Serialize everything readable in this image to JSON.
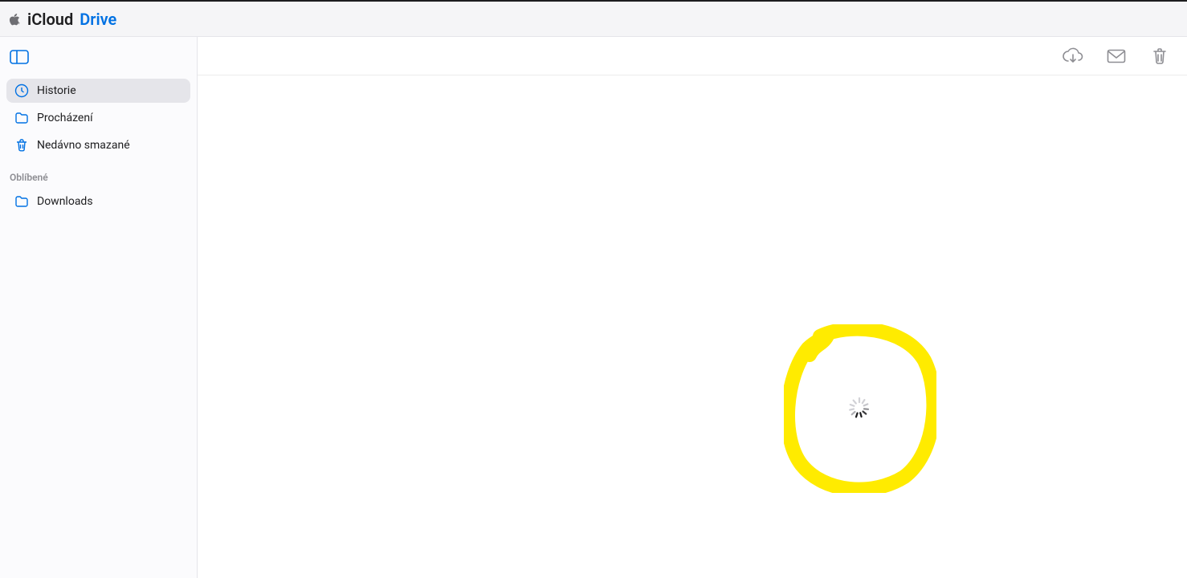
{
  "header": {
    "title_left": "iCloud",
    "title_right": "Drive"
  },
  "sidebar": {
    "items": [
      {
        "icon": "clock",
        "label": "Historie",
        "selected": true
      },
      {
        "icon": "folder",
        "label": "Procházení",
        "selected": false
      },
      {
        "icon": "trash",
        "label": "Nedávno smazané",
        "selected": false
      }
    ],
    "favorites_header": "Oblíbené",
    "favorites": [
      {
        "icon": "folder",
        "label": "Downloads"
      }
    ]
  },
  "toolbar": {
    "download_icon": "cloud-download",
    "share_icon": "envelope",
    "delete_icon": "trash"
  },
  "colors": {
    "accent": "#0071e3",
    "annotation": "#ffeb00"
  }
}
